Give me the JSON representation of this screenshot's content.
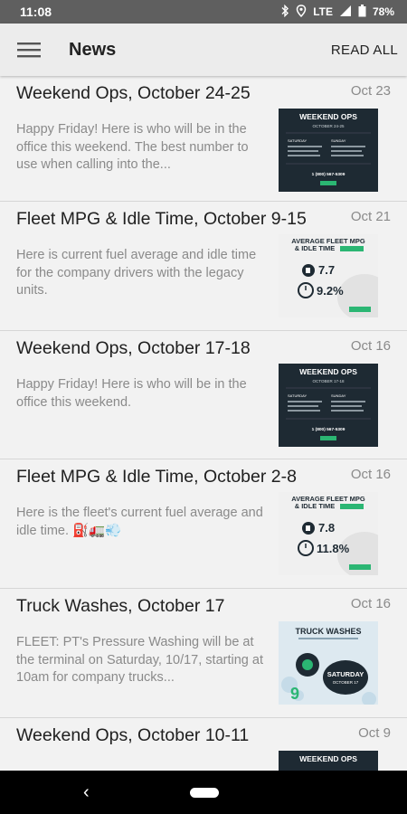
{
  "status": {
    "time": "11:08",
    "network": "LTE",
    "battery": "78%"
  },
  "header": {
    "title": "News",
    "action": "READ ALL"
  },
  "items": [
    {
      "title": "Weekend Ops, October 24-25",
      "date": "Oct 23",
      "body": "Happy Friday! Here is who will be in the office this weekend. The best number to use when calling into the..."
    },
    {
      "title": "Fleet MPG & Idle Time, October 9-15",
      "date": "Oct 21",
      "body": "Here is current fuel average and idle time for the company drivers with the legacy units."
    },
    {
      "title": "Weekend Ops, October 17-18",
      "date": "Oct 16",
      "body": "Happy Friday! Here is who will be in the office this weekend."
    },
    {
      "title": "Fleet MPG & Idle Time, October 2-8",
      "date": "Oct 16",
      "body": "Here is the fleet's current fuel average and idle time. ⛽🚛💨"
    },
    {
      "title": "Truck Washes, October 17",
      "date": "Oct 16",
      "body": "FLEET: PT's Pressure Washing will be at the terminal on Saturday, 10/17, starting at 10am for company trucks..."
    },
    {
      "title": "Weekend Ops, October 10-11",
      "date": "Oct 9",
      "body": ""
    }
  ],
  "thumbs": {
    "ops1": {
      "heading": "WEEKEND OPS",
      "sub": "OCTOBER 24-25",
      "col1": "SATURDAY",
      "col2": "SUNDAY",
      "phone": "1 (800) 567-5309"
    },
    "mpg1": {
      "heading1": "AVERAGE FLEET MPG",
      "heading2": "& IDLE TIME",
      "mpg": "7.7",
      "idle": "9.2%"
    },
    "ops2": {
      "heading": "WEEKEND OPS",
      "sub": "OCTOBER 17-18",
      "col1": "SATURDAY",
      "col2": "SUNDAY",
      "phone": "1 (800) 567-5309"
    },
    "mpg2": {
      "heading1": "AVERAGE FLEET MPG",
      "heading2": "& IDLE TIME",
      "mpg": "7.8",
      "idle": "11.8%"
    },
    "wash": {
      "heading": "TRUCK WASHES",
      "day": "SATURDAY",
      "date": "OCTOBER 17"
    },
    "ops3": {
      "heading": "WEEKEND OPS"
    }
  },
  "colors": {
    "status_bar": "#5f5f5f",
    "app_bar": "#ececec",
    "dark_thumb": "#1e2a33",
    "accent_green": "#2bb673"
  }
}
